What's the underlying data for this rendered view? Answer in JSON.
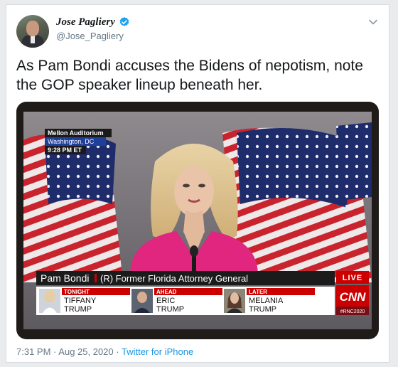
{
  "author": {
    "name": "Jose Pagliery",
    "handle": "@Jose_Pagliery"
  },
  "tweet": {
    "text": "As Pam Bondi accuses the Bidens of nepotism, note the GOP speaker lineup beneath her."
  },
  "broadcast": {
    "location_line1": "Mellon Auditorium",
    "location_line2": "Washington, DC",
    "time": "9:28 PM ET",
    "speaker_name": "Pam Bondi",
    "speaker_title": "(R) Former Florida Attorney General",
    "live_label": "LIVE",
    "network": "CNN",
    "hashtag": "#RNC2020",
    "lineup": [
      {
        "slot": "TONIGHT",
        "first": "TIFFANY",
        "last": "TRUMP"
      },
      {
        "slot": "AHEAD",
        "first": "ERIC",
        "last": "TRUMP"
      },
      {
        "slot": "LATER",
        "first": "MELANIA",
        "last": "TRUMP"
      }
    ]
  },
  "footer": {
    "time": "7:31 PM",
    "date": "Aug 25, 2020",
    "separator": "·",
    "source": "Twitter for iPhone"
  },
  "colors": {
    "verified": "#1da1f2",
    "cnn_red": "#cc0000",
    "link": "#1b95e0"
  }
}
